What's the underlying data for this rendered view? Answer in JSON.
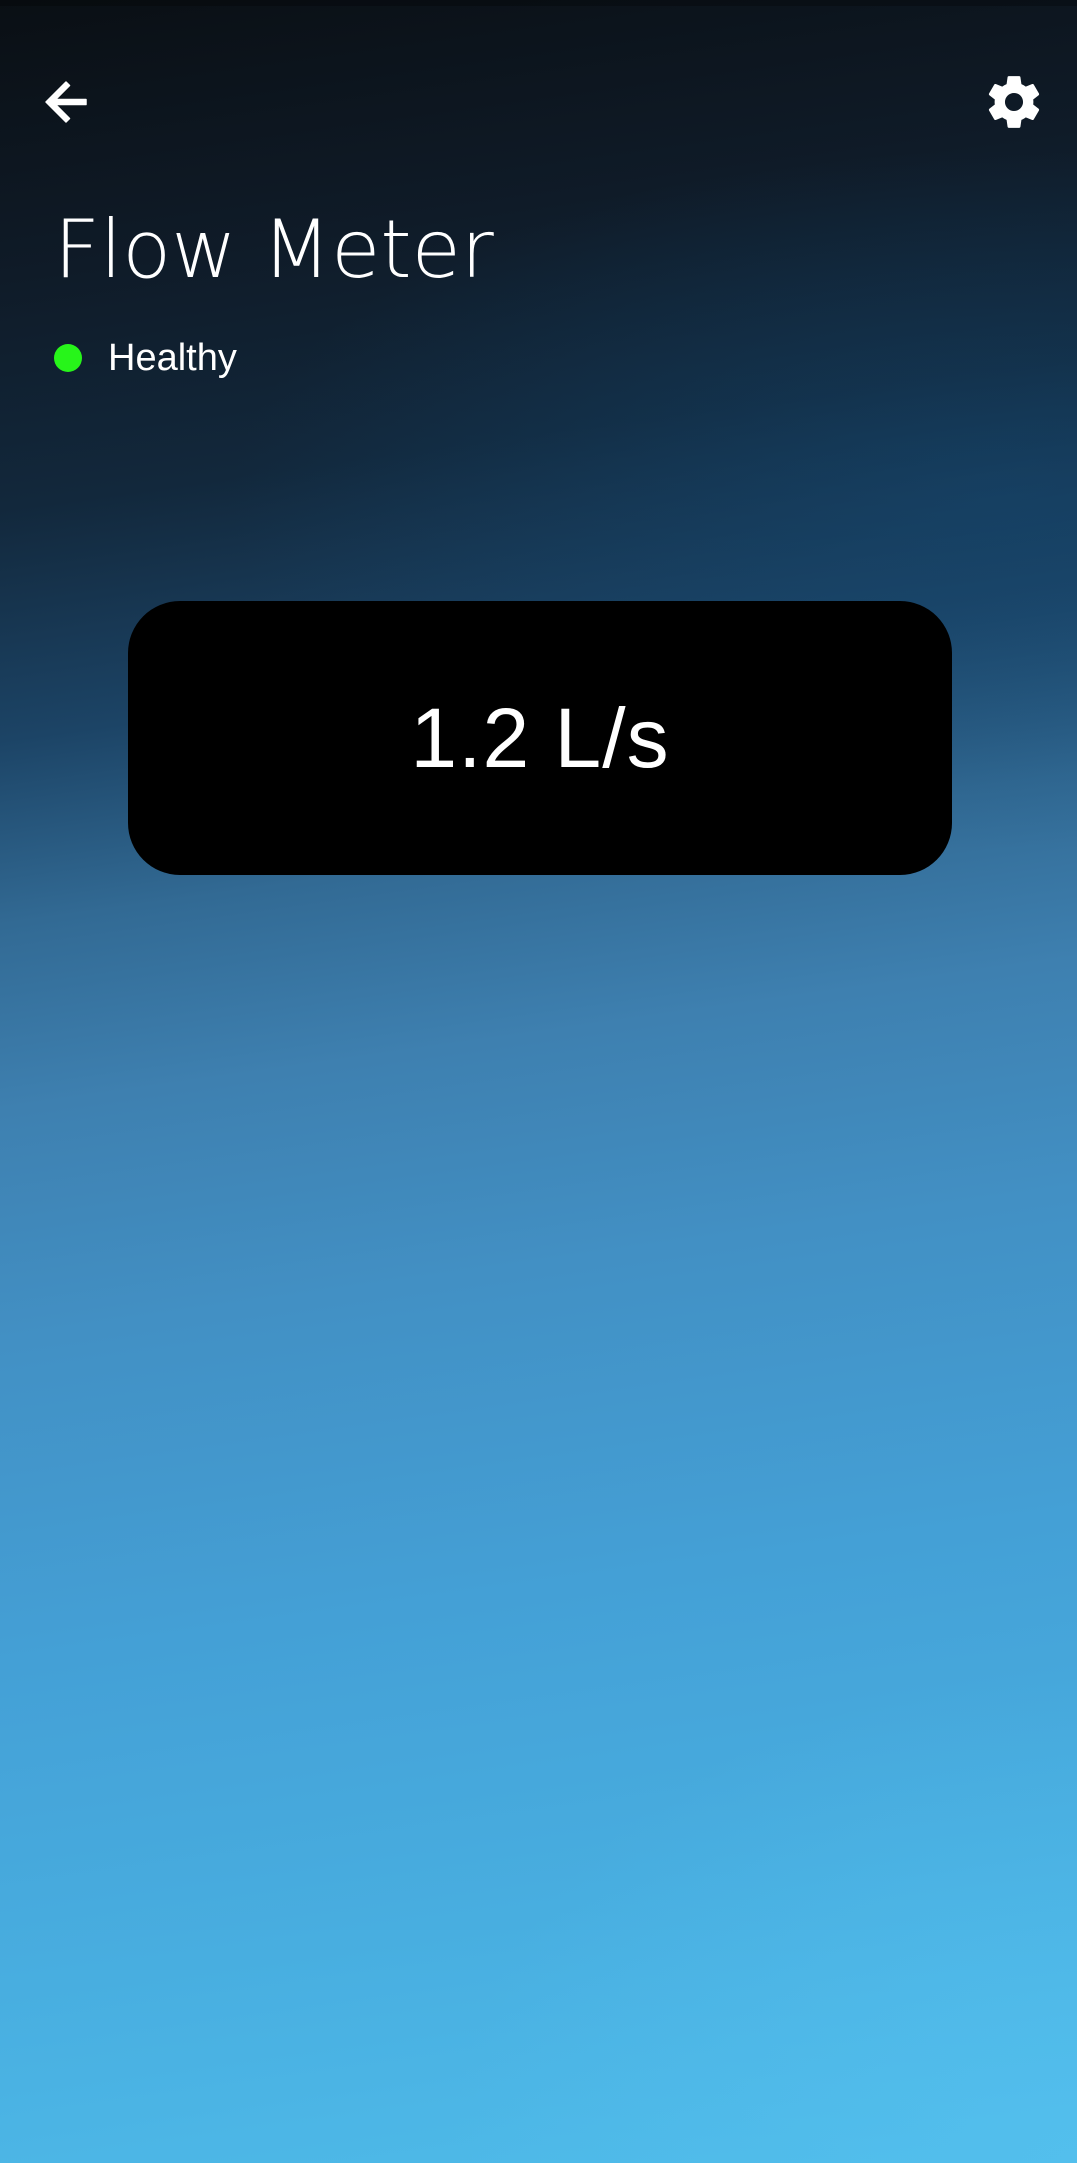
{
  "header": {
    "back_icon": "arrow-left-icon",
    "settings_icon": "gear-icon"
  },
  "title": "Flow Meter",
  "status": {
    "label": "Healthy",
    "color": "#27f51a"
  },
  "reading": {
    "value": "1.2 L/s"
  },
  "colors": {
    "card_background": "#000000",
    "text": "#ffffff"
  }
}
